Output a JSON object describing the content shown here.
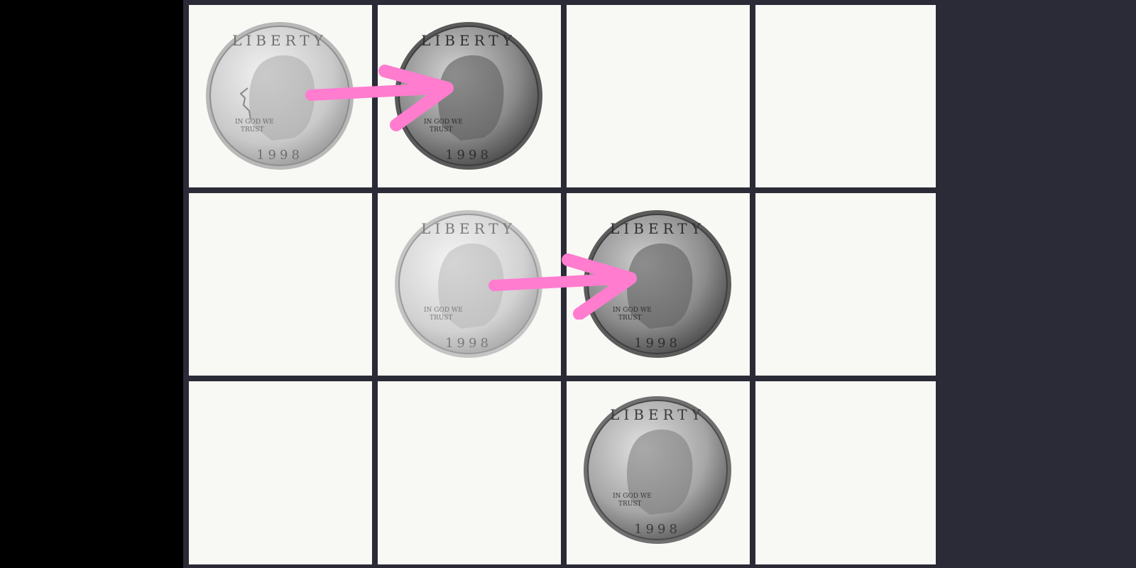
{
  "board": {
    "rows": 3,
    "cols": 4,
    "cells": [
      {
        "row": 0,
        "col": 0,
        "coin": "quarter-coin",
        "shade": "light"
      },
      {
        "row": 0,
        "col": 1,
        "coin": "quarter-coin",
        "shade": "dark"
      },
      {
        "row": 0,
        "col": 2,
        "coin": null
      },
      {
        "row": 0,
        "col": 3,
        "coin": null
      },
      {
        "row": 1,
        "col": 0,
        "coin": null
      },
      {
        "row": 1,
        "col": 1,
        "coin": "quarter-coin",
        "shade": "light"
      },
      {
        "row": 1,
        "col": 2,
        "coin": "quarter-coin",
        "shade": "dark"
      },
      {
        "row": 1,
        "col": 3,
        "coin": null
      },
      {
        "row": 2,
        "col": 0,
        "coin": null
      },
      {
        "row": 2,
        "col": 1,
        "coin": null
      },
      {
        "row": 2,
        "col": 2,
        "coin": "quarter-coin",
        "shade": "medium"
      },
      {
        "row": 2,
        "col": 3,
        "coin": null
      }
    ],
    "moves": [
      {
        "from": [
          0,
          0
        ],
        "to": [
          0,
          1
        ]
      },
      {
        "from": [
          1,
          1
        ],
        "to": [
          1,
          2
        ]
      }
    ]
  },
  "coin_text": {
    "top": "LIBERTY",
    "motto_line1": "IN GOD WE",
    "motto_line2": "TRUST",
    "year": "1998"
  },
  "colors": {
    "board_bg": "#2a2b36",
    "cell_bg": "#f8f8f4",
    "arrow": "#ff7ccf"
  }
}
